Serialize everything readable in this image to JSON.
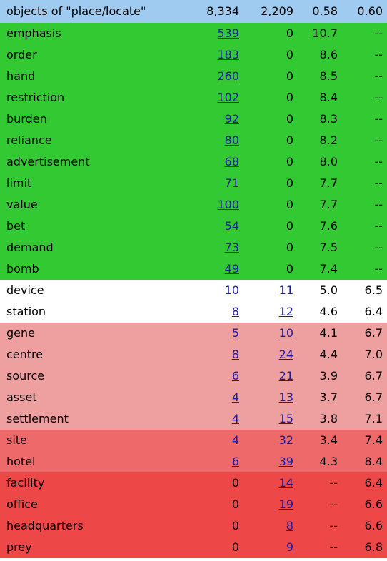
{
  "header": {
    "label": "objects of \"place/locate\"",
    "col1": "8,334",
    "col2": "2,209",
    "col3": "0.58",
    "col4": "0.60"
  },
  "colors": {
    "header": "#9fcbf0",
    "green": "#33c933",
    "white": "#ffffff",
    "pink": "#ee9f9f",
    "salmon": "#ee6a6a",
    "red": "#ee4747",
    "link": "#1a1aa6"
  },
  "rows": [
    {
      "word": "emphasis",
      "c1": "539",
      "c1_link": true,
      "c2": "0",
      "c2_link": false,
      "c3": "10.7",
      "c4": "--",
      "color": "green"
    },
    {
      "word": "order",
      "c1": "183",
      "c1_link": true,
      "c2": "0",
      "c2_link": false,
      "c3": "8.6",
      "c4": "--",
      "color": "green"
    },
    {
      "word": "hand",
      "c1": "260",
      "c1_link": true,
      "c2": "0",
      "c2_link": false,
      "c3": "8.5",
      "c4": "--",
      "color": "green"
    },
    {
      "word": "restriction",
      "c1": "102",
      "c1_link": true,
      "c2": "0",
      "c2_link": false,
      "c3": "8.4",
      "c4": "--",
      "color": "green"
    },
    {
      "word": "burden",
      "c1": "92",
      "c1_link": true,
      "c2": "0",
      "c2_link": false,
      "c3": "8.3",
      "c4": "--",
      "color": "green"
    },
    {
      "word": "reliance",
      "c1": "80",
      "c1_link": true,
      "c2": "0",
      "c2_link": false,
      "c3": "8.2",
      "c4": "--",
      "color": "green"
    },
    {
      "word": "advertisement",
      "c1": "68",
      "c1_link": true,
      "c2": "0",
      "c2_link": false,
      "c3": "8.0",
      "c4": "--",
      "color": "green"
    },
    {
      "word": "limit",
      "c1": "71",
      "c1_link": true,
      "c2": "0",
      "c2_link": false,
      "c3": "7.7",
      "c4": "--",
      "color": "green"
    },
    {
      "word": "value",
      "c1": "100",
      "c1_link": true,
      "c2": "0",
      "c2_link": false,
      "c3": "7.7",
      "c4": "--",
      "color": "green"
    },
    {
      "word": "bet",
      "c1": "54",
      "c1_link": true,
      "c2": "0",
      "c2_link": false,
      "c3": "7.6",
      "c4": "--",
      "color": "green"
    },
    {
      "word": "demand",
      "c1": "73",
      "c1_link": true,
      "c2": "0",
      "c2_link": false,
      "c3": "7.5",
      "c4": "--",
      "color": "green"
    },
    {
      "word": "bomb",
      "c1": "49",
      "c1_link": true,
      "c2": "0",
      "c2_link": false,
      "c3": "7.4",
      "c4": "--",
      "color": "green"
    },
    {
      "word": "device",
      "c1": "10",
      "c1_link": true,
      "c2": "11",
      "c2_link": true,
      "c3": "5.0",
      "c4": "6.5",
      "color": "white"
    },
    {
      "word": "station",
      "c1": "8",
      "c1_link": true,
      "c2": "12",
      "c2_link": true,
      "c3": "4.6",
      "c4": "6.4",
      "color": "white"
    },
    {
      "word": "gene",
      "c1": "5",
      "c1_link": true,
      "c2": "10",
      "c2_link": true,
      "c3": "4.1",
      "c4": "6.7",
      "color": "pink"
    },
    {
      "word": "centre",
      "c1": "8",
      "c1_link": true,
      "c2": "24",
      "c2_link": true,
      "c3": "4.4",
      "c4": "7.0",
      "color": "pink"
    },
    {
      "word": "source",
      "c1": "6",
      "c1_link": true,
      "c2": "21",
      "c2_link": true,
      "c3": "3.9",
      "c4": "6.7",
      "color": "pink"
    },
    {
      "word": "asset",
      "c1": "4",
      "c1_link": true,
      "c2": "13",
      "c2_link": true,
      "c3": "3.7",
      "c4": "6.7",
      "color": "pink"
    },
    {
      "word": "settlement",
      "c1": "4",
      "c1_link": true,
      "c2": "15",
      "c2_link": true,
      "c3": "3.8",
      "c4": "7.1",
      "color": "pink"
    },
    {
      "word": "site",
      "c1": "4",
      "c1_link": true,
      "c2": "32",
      "c2_link": true,
      "c3": "3.4",
      "c4": "7.4",
      "color": "salmon"
    },
    {
      "word": "hotel",
      "c1": "6",
      "c1_link": true,
      "c2": "39",
      "c2_link": true,
      "c3": "4.3",
      "c4": "8.4",
      "color": "salmon"
    },
    {
      "word": "facility",
      "c1": "0",
      "c1_link": false,
      "c2": "14",
      "c2_link": true,
      "c3": "--",
      "c4": "6.4",
      "color": "red"
    },
    {
      "word": "office",
      "c1": "0",
      "c1_link": false,
      "c2": "19",
      "c2_link": true,
      "c3": "--",
      "c4": "6.6",
      "color": "red"
    },
    {
      "word": "headquarters",
      "c1": "0",
      "c1_link": false,
      "c2": "8",
      "c2_link": true,
      "c3": "--",
      "c4": "6.6",
      "color": "red"
    },
    {
      "word": "prey",
      "c1": "0",
      "c1_link": false,
      "c2": "9",
      "c2_link": true,
      "c3": "--",
      "c4": "6.8",
      "color": "red"
    }
  ]
}
